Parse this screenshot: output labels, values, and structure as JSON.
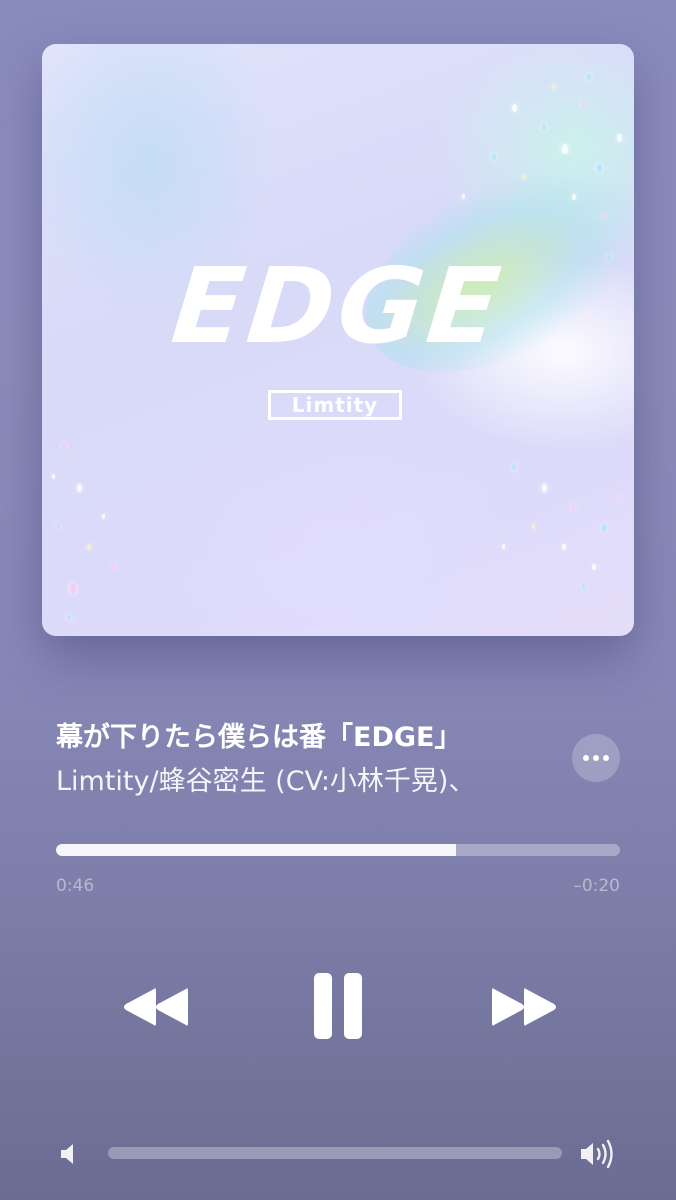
{
  "album_art": {
    "logo_text": "EDGE",
    "badge_text": "Limtity"
  },
  "now_playing": {
    "title": "幕が下りたら僕らは番「EDGE」",
    "artist": "Limtity/蜂谷密生 (CV:小林千晃)、"
  },
  "playback": {
    "elapsed": "0:46",
    "remaining": "–0:20",
    "progress_fraction": 0.71,
    "state": "playing"
  },
  "volume": {
    "level_fraction": 0.0
  },
  "icons": {
    "more": "ellipsis-icon",
    "rewind": "rewind-icon",
    "pause": "pause-icon",
    "forward": "fast-forward-icon",
    "volume_low": "speaker-low-icon",
    "volume_high": "speaker-high-icon"
  },
  "colors": {
    "background_top": "#8a8bbd",
    "background_bottom": "#6b6c92",
    "foreground": "#ffffff"
  }
}
